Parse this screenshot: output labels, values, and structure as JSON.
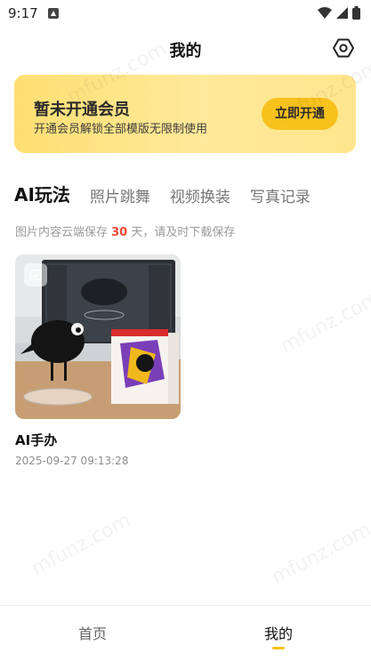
{
  "status_bar": {
    "time": "9:17"
  },
  "header": {
    "title": "我的"
  },
  "vip_banner": {
    "title": "暂未开通会员",
    "subtitle": "开通会员解锁全部模版无限制使用",
    "button_label": "立即开通"
  },
  "tabs": [
    {
      "label": "AI玩法",
      "active": true
    },
    {
      "label": "照片跳舞",
      "active": false
    },
    {
      "label": "视频换装",
      "active": false
    },
    {
      "label": "写真记录",
      "active": false
    }
  ],
  "notice": {
    "prefix": "图片内容云端保存 ",
    "days": "30",
    "suffix": " 天，请及时下载保存"
  },
  "items": [
    {
      "title": "AI手办",
      "date": "2025-09-27 09:13:28"
    }
  ],
  "watermark_text": "mfunz.com",
  "bottom_nav": [
    {
      "label": "首页",
      "active": false
    },
    {
      "label": "我的",
      "active": true
    }
  ],
  "colors": {
    "accent": "#f8c21d",
    "highlight": "#ef4a35",
    "banner_start": "#ffdf73"
  }
}
